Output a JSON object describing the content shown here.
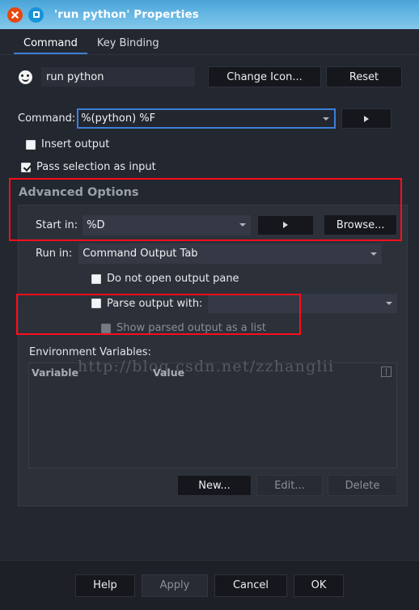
{
  "window": {
    "title": "'run python' Properties",
    "close_icon": "close-icon",
    "maximize_icon": "maximize-icon"
  },
  "tabs": [
    {
      "label": "Command",
      "active": true
    },
    {
      "label": "Key Binding",
      "active": false
    }
  ],
  "name_row": {
    "icon": "smiley-face-icon",
    "value": "run python",
    "placeholder": "",
    "change_icon_label": "Change Icon...",
    "reset_label": "Reset"
  },
  "command": {
    "label": "Command:",
    "value": "%(python)  %F",
    "expand_button_icon": "play-arrow-icon",
    "insert_output_label": "Insert output",
    "insert_output_checked": false,
    "pass_selection_label": "Pass selection as input",
    "pass_selection_checked": true
  },
  "advanced": {
    "title": "Advanced Options",
    "start_in_label": "Start in:",
    "start_in_value": "%D",
    "start_in_expand_icon": "play-arrow-icon",
    "browse_label": "Browse...",
    "run_in_label": "Run in:",
    "run_in_value": "Command Output Tab",
    "do_not_open_label": "Do not open output pane",
    "do_not_open_checked": false,
    "parse_output_label": "Parse output with:",
    "parse_output_checked": false,
    "parse_output_value": "",
    "show_parsed_label": "Show parsed output as a list",
    "show_parsed_checked": false,
    "show_parsed_disabled": true
  },
  "environment": {
    "label": "Environment Variables:",
    "columns": [
      "Variable",
      "Value"
    ],
    "rows": [],
    "column_picker_icon": "column-picker-icon",
    "new_label": "New...",
    "edit_label": "Edit...",
    "delete_label": "Delete"
  },
  "footer": {
    "help_label": "Help",
    "apply_label": "Apply",
    "cancel_label": "Cancel",
    "ok_label": "OK"
  },
  "watermark": {
    "text": "http://blog.csdn.net/zzhanglii"
  },
  "colors": {
    "titlebar_start": "#4aa3d6",
    "titlebar_end": "#82c7ea",
    "dialog_bg": "#232730",
    "group_bg": "#2c3039",
    "accent_tab": "#3f7fd0",
    "focus_border": "#3d7fd6",
    "annotation_red": "#fc0d1b",
    "close_button": "#e8470f",
    "max_button": "#1793d8"
  }
}
